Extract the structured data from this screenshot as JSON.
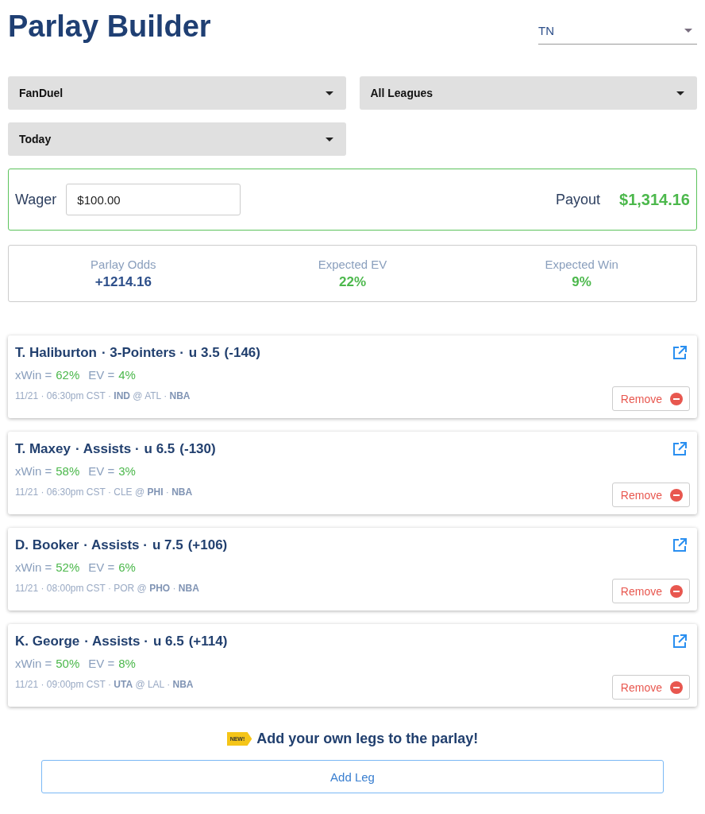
{
  "title": "Parlay Builder",
  "state_select": {
    "value": "TN"
  },
  "filters": [
    {
      "value": "FanDuel"
    },
    {
      "value": "All Leagues"
    },
    {
      "value": "Today"
    }
  ],
  "wager": {
    "label": "Wager",
    "value": "$100.00",
    "payout_label": "Payout",
    "payout": "$1,314.16"
  },
  "stats": [
    {
      "label": "Parlay Odds",
      "value": "+1214.16",
      "kind": "neutral"
    },
    {
      "label": "Expected EV",
      "value": "22%",
      "kind": "positive"
    },
    {
      "label": "Expected Win",
      "value": "9%",
      "kind": "positive"
    }
  ],
  "legs": [
    {
      "player": "T. Haliburton",
      "market": "· 3-Pointers ·",
      "line": "u 3.5",
      "odds": "(-146)",
      "xwin_label": "xWin =",
      "xwin": "62%",
      "ev_label": "EV =",
      "ev": "4%",
      "meta": "11/21 · 06:30pm CST · **IND** @ ATL · **NBA**",
      "remove": "Remove"
    },
    {
      "player": "T. Maxey",
      "market": "· Assists ·",
      "line": "u 6.5",
      "odds": "(-130)",
      "xwin_label": "xWin =",
      "xwin": "58%",
      "ev_label": "EV =",
      "ev": "3%",
      "meta": "11/21 · 06:30pm CST · CLE @ **PHI** · **NBA**",
      "remove": "Remove"
    },
    {
      "player": "D. Booker",
      "market": "· Assists ·",
      "line": "u 7.5",
      "odds": "(+106)",
      "xwin_label": "xWin =",
      "xwin": "52%",
      "ev_label": "EV =",
      "ev": "6%",
      "meta": "11/21 · 08:00pm CST · POR @ **PHO** · **NBA**",
      "remove": "Remove"
    },
    {
      "player": "K. George",
      "market": "· Assists ·",
      "line": "u 6.5",
      "odds": "(+114)",
      "xwin_label": "xWin =",
      "xwin": "50%",
      "ev_label": "EV =",
      "ev": "8%",
      "meta": "11/21 · 09:00pm CST · **UTA** @ LAL · **NBA**",
      "remove": "Remove"
    }
  ],
  "promo": {
    "badge": "NEW!",
    "text": "Add your own legs to the parlay!"
  },
  "add_button": "Add Leg"
}
